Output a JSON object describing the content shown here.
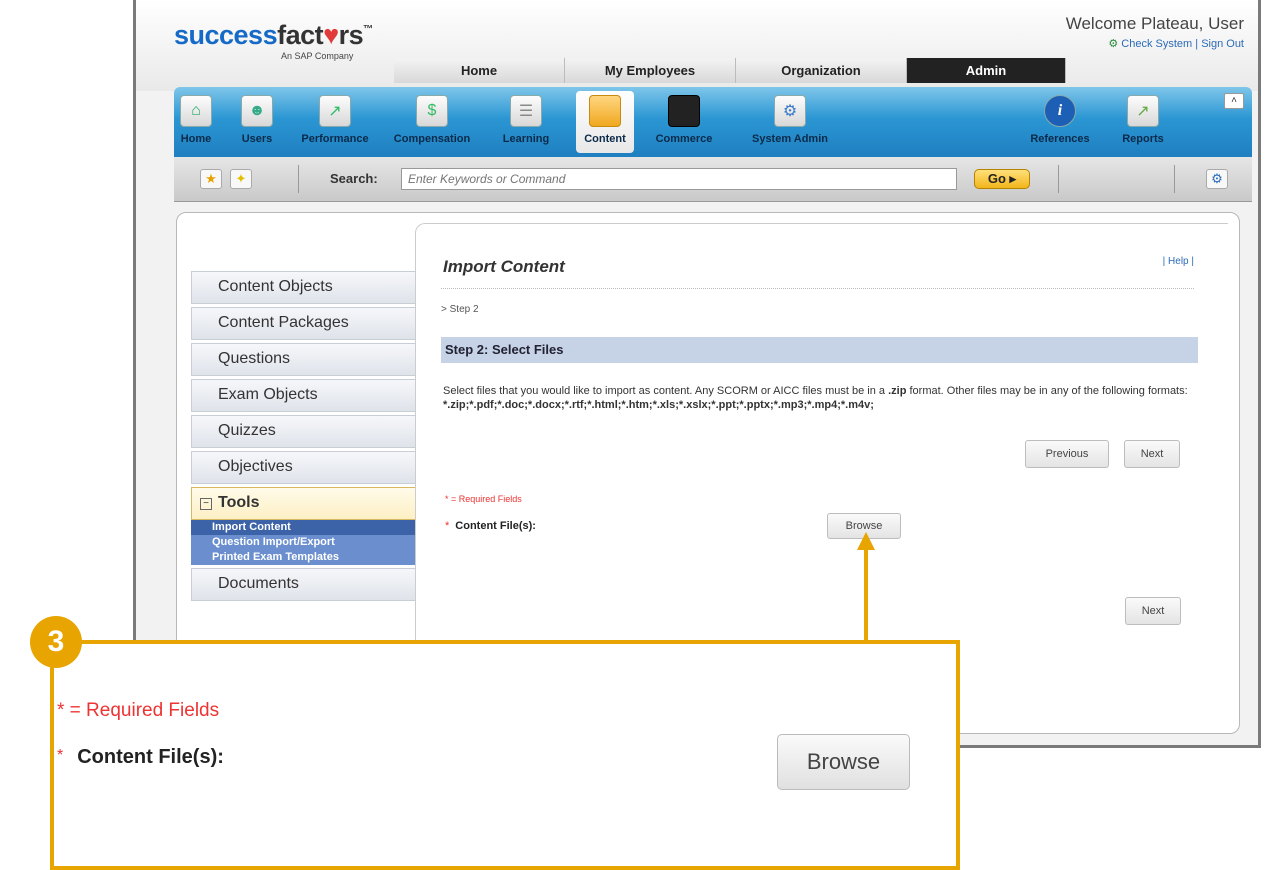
{
  "header": {
    "logo": {
      "part1": "success",
      "part2": "fact",
      "heart": "♥",
      "part3": "rs",
      "tm": "™",
      "tagline": "An SAP Company"
    },
    "welcome": "Welcome Plateau, User",
    "check_system": "Check System",
    "sep": "|",
    "sign_out": "Sign Out"
  },
  "main_tabs": [
    {
      "label": "Home"
    },
    {
      "label": "My Employees"
    },
    {
      "label": "Organization"
    },
    {
      "label": "Admin",
      "active": true
    }
  ],
  "icon_bar": [
    {
      "label": "Home",
      "icon": "home-icon"
    },
    {
      "label": "Users",
      "icon": "users-icon"
    },
    {
      "label": "Performance",
      "icon": "performance-icon"
    },
    {
      "label": "Compensation",
      "icon": "compensation-icon"
    },
    {
      "label": "Learning",
      "icon": "learning-icon"
    },
    {
      "label": "Content",
      "icon": "folder-icon",
      "active": true
    },
    {
      "label": "Commerce",
      "icon": "briefcase-icon"
    },
    {
      "label": "System Admin",
      "icon": "system-admin-icon"
    },
    {
      "label": "References",
      "icon": "info-icon"
    },
    {
      "label": "Reports",
      "icon": "reports-icon"
    }
  ],
  "search": {
    "label": "Search:",
    "placeholder": "Enter Keywords or Command",
    "go": "Go ▸"
  },
  "sidebar": {
    "items": [
      {
        "label": "Content Objects"
      },
      {
        "label": "Content Packages"
      },
      {
        "label": "Questions"
      },
      {
        "label": "Exam Objects"
      },
      {
        "label": "Quizzes"
      },
      {
        "label": "Objectives"
      }
    ],
    "tools": {
      "label": "Tools",
      "toggle": "−",
      "subitems": [
        {
          "label": "Import Content",
          "selected": true
        },
        {
          "label": "Question Import/Export"
        },
        {
          "label": "Printed Exam Templates"
        }
      ]
    },
    "after": [
      {
        "label": "Documents"
      }
    ]
  },
  "main": {
    "title": "Import Content",
    "help": "| Help |",
    "breadcrumb": "> Step 2",
    "step_title": "Step 2: Select Files",
    "description_1": "Select files that you would like to import as content. Any SCORM or AICC files must be in a ",
    "description_zip": ".zip",
    "description_2": " format. Other files may be in any of the following formats: ",
    "description_formats": "*.zip;*.pdf;*.doc;*.docx;*.rtf;*.html;*.htm;*.xls;*.xslx;*.ppt;*.pptx;*.mp3;*.mp4;*.m4v;",
    "previous": "Previous",
    "next": "Next",
    "required_note": "* = Required Fields",
    "required_star": "*",
    "content_file_label": "Content File(s):",
    "browse": "Browse",
    "next_bottom": "Next"
  },
  "callout": {
    "step_number": "3",
    "required_note": "* = Required Fields",
    "required_star": "*",
    "content_file_label": "Content File(s):",
    "browse": "Browse"
  },
  "colors": {
    "accent_callout": "#e8a400",
    "brand_blue": "#1569c7",
    "required_red": "#e33333",
    "iconbar_blue": "#2b96d3"
  }
}
